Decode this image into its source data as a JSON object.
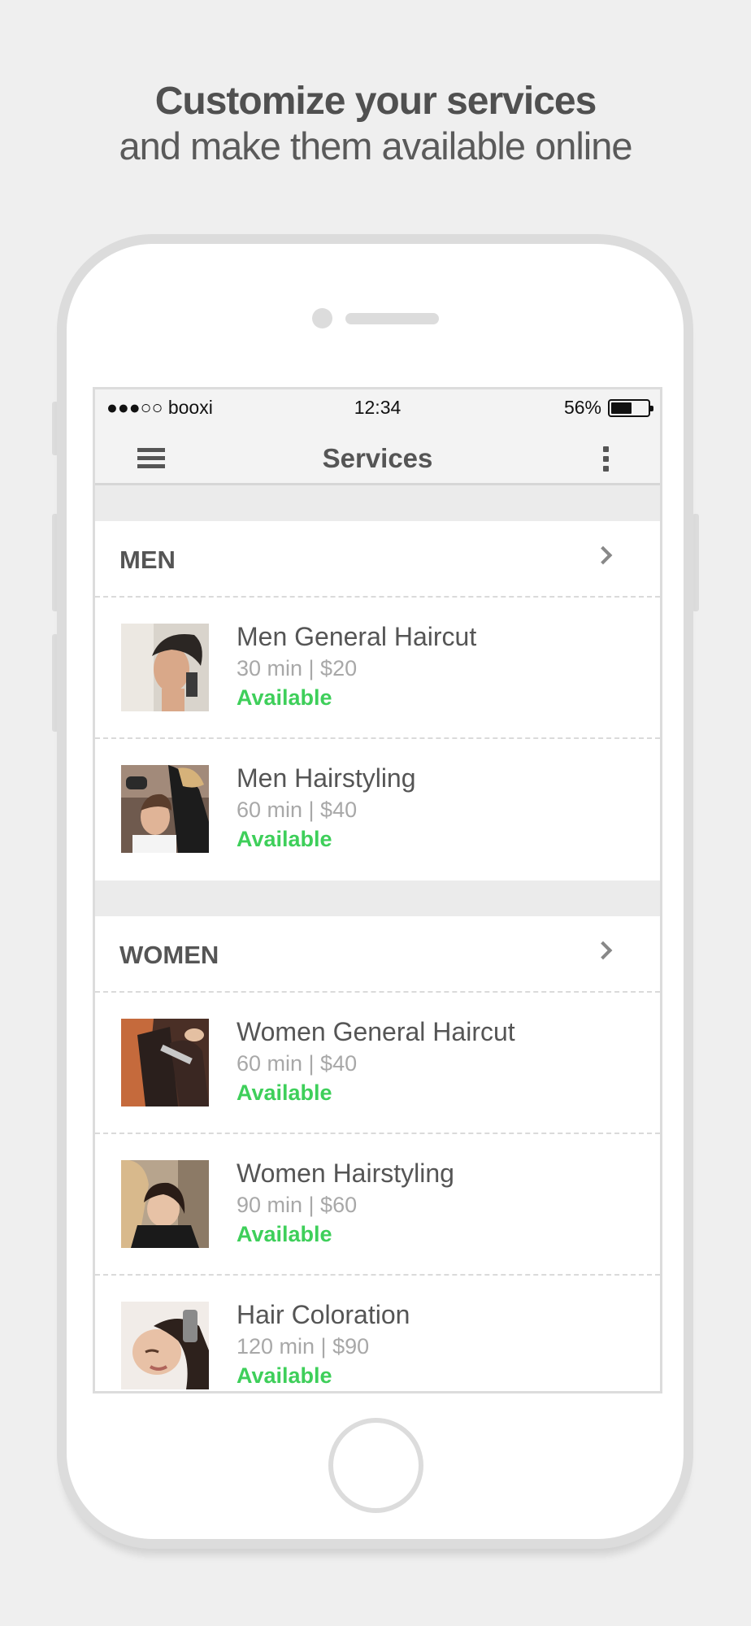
{
  "headline": {
    "line1": "Customize your services",
    "line2": "and make them available online"
  },
  "status_bar": {
    "carrier": "●●●○○ booxi",
    "time": "12:34",
    "battery": "56%",
    "battery_level": 0.56
  },
  "nav": {
    "title": "Services",
    "menu_icon": "hamburger-menu-icon",
    "more_icon": "more-vertical-icon"
  },
  "sections": [
    {
      "title": "MEN",
      "items": [
        {
          "name": "Men General Haircut",
          "meta": "30 min | $20",
          "status": "Available"
        },
        {
          "name": "Men Hairstyling",
          "meta": "60 min | $40",
          "status": "Available"
        }
      ]
    },
    {
      "title": "WOMEN",
      "items": [
        {
          "name": "Women General Haircut",
          "meta": "60 min | $40",
          "status": "Available"
        },
        {
          "name": "Women Hairstyling",
          "meta": "90 min | $60",
          "status": "Available"
        },
        {
          "name": "Hair Coloration",
          "meta": "120 min | $90",
          "status": "Available"
        }
      ]
    }
  ],
  "colors": {
    "available": "#3ecf5a",
    "text": "#555555",
    "muted": "#a8a8a8",
    "background": "#efefef"
  }
}
